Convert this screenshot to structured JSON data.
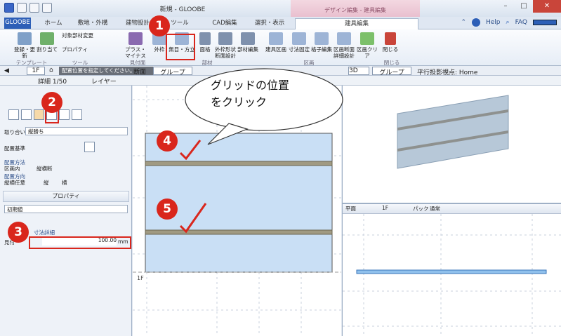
{
  "titlebar": {
    "title": "新規 - GLOOBE",
    "ctx_group": "デザイン編集 - 建具編集"
  },
  "tabs": [
    "GLOOBE",
    "ホーム",
    "敷地・外構",
    "建物設計",
    "ツール",
    "CAD編集",
    "選択・表示",
    "建具編集"
  ],
  "help": {
    "help_label": "Help",
    "faq_label": "FAQ"
  },
  "ribbon": {
    "buttons": [
      "登録・更新",
      "割り当て",
      "対象部材変更",
      "プロパティ",
      "プラス・マイナス",
      "外枠",
      "無目・方立",
      "面格",
      "外枠形状断面設計",
      "部材編集",
      "建具区画",
      "寸法固定",
      "格子編集",
      "区画断面詳細設計",
      "区画クリア",
      "閉じる"
    ],
    "groups": [
      "テンプレート",
      "ツール",
      "見付面",
      "部材",
      "区画",
      "閉じる"
    ]
  },
  "row2": {
    "floor": "1F",
    "hint": "配置位置を指定してください。",
    "tab_label": "断面",
    "group": "グループ",
    "view3d_tab": "3D",
    "view3d_group": "グループ",
    "view3d_proj": "平行投影",
    "view3d_viewpoint": "視点: Home"
  },
  "row3": {
    "scale": "詳細 1/50",
    "layer": "レイヤー"
  },
  "left": {
    "junction_label": "取り合い",
    "junction_value": "縦勝ち",
    "base_label": "配置基準",
    "method_label": "配置方法",
    "method_opts": [
      "区画内",
      "縦横断"
    ],
    "dir_label": "配置方向",
    "dir_opts": [
      "縦横任意",
      "縦",
      "横"
    ],
    "props_title": "プロパティ",
    "preset": "初期値",
    "section_label": "寸法詳細",
    "width_label": "見付",
    "width_value": "100.00",
    "width_unit": "mm"
  },
  "callout": {
    "line1": "グリッドの位置",
    "line2": "をクリック"
  },
  "center": {
    "axis_label": "1F"
  },
  "bottom": {
    "view": "平面",
    "floor": "1F",
    "mode": "パック",
    "mode2": "通常"
  },
  "badges": [
    "1",
    "2",
    "3",
    "4",
    "5"
  ],
  "colors": {
    "accent": "#d9261c",
    "panel": "#c9dff5",
    "mullion": "#a09a82"
  }
}
